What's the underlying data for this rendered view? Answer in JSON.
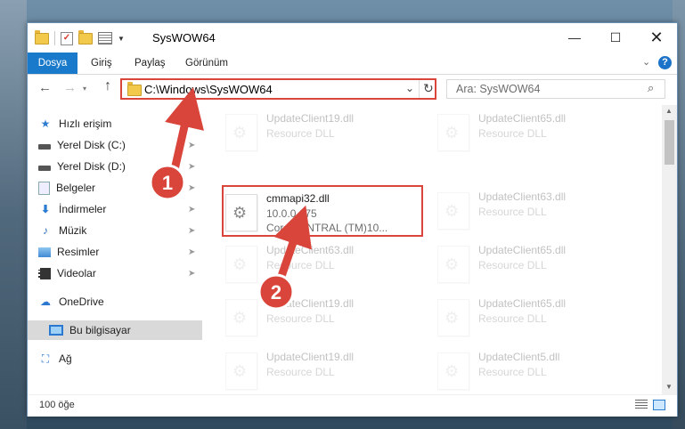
{
  "window": {
    "title": "SysWOW64",
    "min_label": "—",
    "max_label": "☐",
    "close_label": "✕"
  },
  "ribbon": {
    "tabs": [
      "Dosya",
      "Giriş",
      "Paylaş",
      "Görünüm"
    ],
    "chevron": "⌄",
    "help": "?"
  },
  "nav": {
    "back": "←",
    "forward": "→",
    "recent": "▾",
    "up": "↑",
    "address": "C:\\Windows\\SysWOW64",
    "address_caret": "⌄",
    "refresh": "↻",
    "search_placeholder": "Ara: SysWOW64",
    "search_icon": "⌕"
  },
  "sidebar": {
    "items": [
      {
        "label": "Hızlı erişim",
        "icon": "star-icon",
        "glyph": "★",
        "pinned": false
      },
      {
        "label": "Yerel Disk (C:)",
        "icon": "disk-icon",
        "glyph": "",
        "pinned": true
      },
      {
        "label": "Yerel Disk (D:)",
        "icon": "disk-icon",
        "glyph": "",
        "pinned": true
      },
      {
        "label": "Belgeler",
        "icon": "document-icon",
        "glyph": "",
        "pinned": true
      },
      {
        "label": "İndirmeler",
        "icon": "download-icon",
        "glyph": "⬇",
        "pinned": true
      },
      {
        "label": "Müzik",
        "icon": "music-icon",
        "glyph": "♪",
        "pinned": true
      },
      {
        "label": "Resimler",
        "icon": "pictures-icon",
        "glyph": "",
        "pinned": true
      },
      {
        "label": "Videolar",
        "icon": "video-icon",
        "glyph": "",
        "pinned": true
      },
      {
        "label": "OneDrive",
        "icon": "onedrive-icon",
        "glyph": "☁",
        "pinned": false
      },
      {
        "label": "Bu bilgisayar",
        "icon": "this-pc-icon",
        "glyph": "",
        "pinned": false,
        "selected": true
      },
      {
        "label": "Ağ",
        "icon": "network-icon",
        "glyph": "⛶",
        "pinned": false
      }
    ],
    "pin_glyph": "📌"
  },
  "files": {
    "left": [
      {
        "name": "UpdateClient19.dll",
        "desc": "Resource DLL"
      },
      {
        "name": "cmmapi32.dll",
        "desc": "10.0.0.675",
        "desc2": "CorelCENTRAL (TM)10...",
        "highlighted": true
      },
      {
        "name": "UpdateClient63.dll",
        "desc": "Resource DLL"
      },
      {
        "name": "UpdateClient19.dll",
        "desc": "Resource DLL"
      },
      {
        "name": "UpdateClient19.dll",
        "desc": "Resource DLL"
      },
      {
        "name": "UpdateClient19.dll",
        "desc": "Resource DLL"
      }
    ],
    "right": [
      {
        "name": "UpdateClient65.dll",
        "desc": "Resource DLL"
      },
      {
        "name": "UpdateClient63.dll",
        "desc": "Resource DLL"
      },
      {
        "name": "UpdateClient65.dll",
        "desc": "Resource DLL"
      },
      {
        "name": "UpdateClient65.dll",
        "desc": "Resource DLL"
      },
      {
        "name": "UpdateClient5.dll",
        "desc": "Resource DLL"
      }
    ]
  },
  "status": {
    "item_count": "100 öğe"
  },
  "annotations": {
    "step1": "1",
    "step2": "2",
    "color": "#d9453a"
  }
}
